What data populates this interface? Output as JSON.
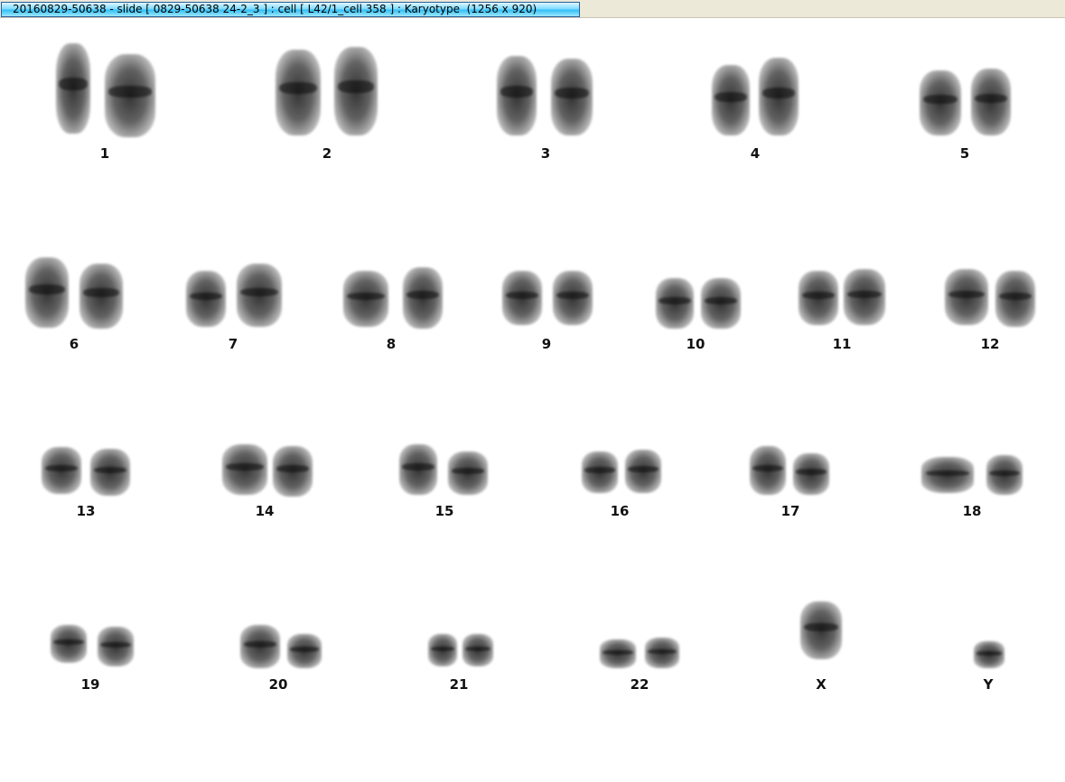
{
  "window": {
    "title": "20160829-50638 - slide [ 0829-50638 24-2_3 ] : cell [ L42/1_cell 358 ] : Karyotype  (1256 x 920)"
  },
  "karyotype": {
    "labels": [
      "1",
      "2",
      "3",
      "4",
      "5",
      "6",
      "7",
      "8",
      "9",
      "10",
      "11",
      "12",
      "13",
      "14",
      "15",
      "16",
      "17",
      "18",
      "19",
      "20",
      "21",
      "22",
      "X",
      "Y"
    ]
  }
}
